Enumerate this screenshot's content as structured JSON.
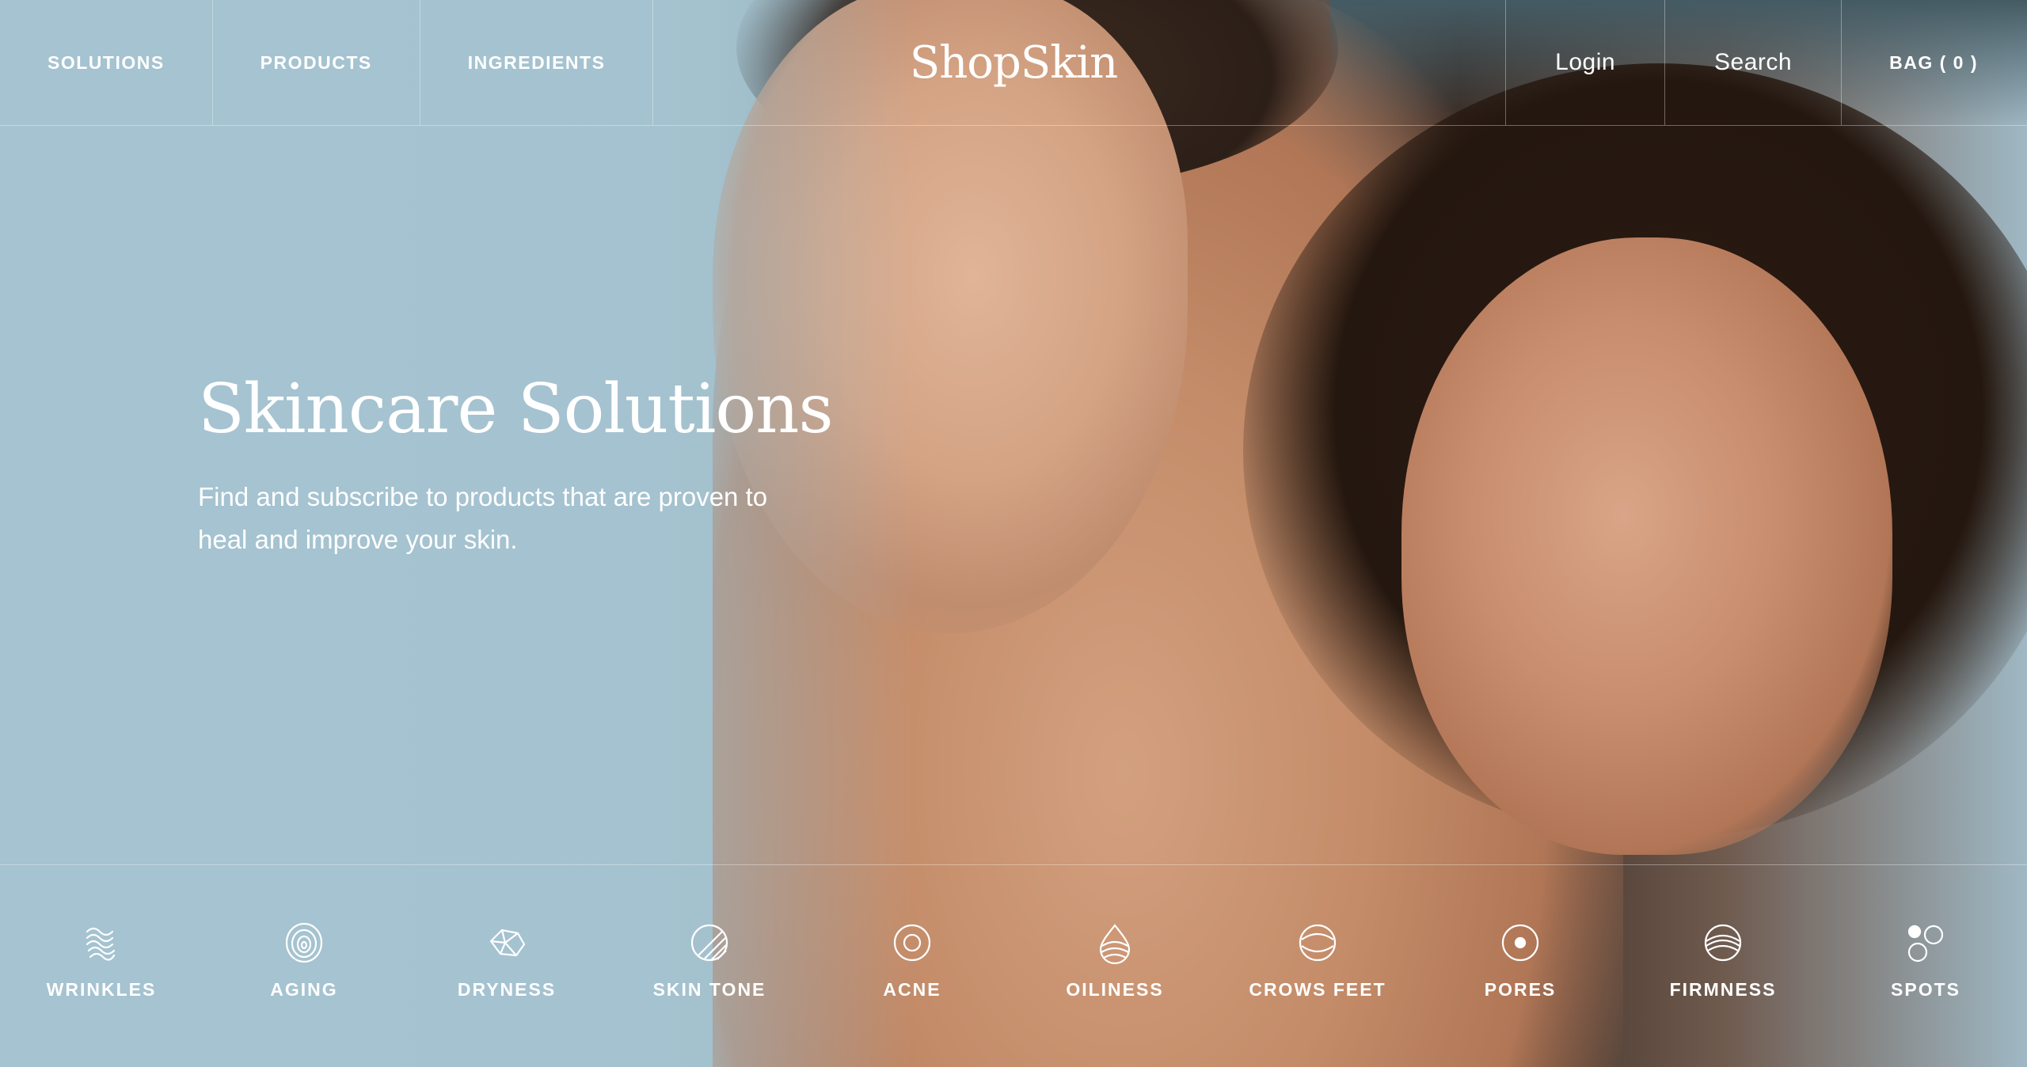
{
  "nav": {
    "left": [
      {
        "label": "SOLUTIONS"
      },
      {
        "label": "PRODUCTS"
      },
      {
        "label": "INGREDIENTS"
      }
    ],
    "brand": "ShopSkin",
    "right": [
      {
        "label": "Login"
      },
      {
        "label": "Search"
      },
      {
        "label": "BAG ( 0 )"
      }
    ]
  },
  "hero": {
    "title": "Skincare Solutions",
    "subtitle": "Find and subscribe to products that are proven to heal and improve your skin."
  },
  "categories": [
    {
      "label": "WRINKLES",
      "icon": "wrinkles-icon"
    },
    {
      "label": "AGING",
      "icon": "aging-icon"
    },
    {
      "label": "DRYNESS",
      "icon": "dryness-icon"
    },
    {
      "label": "SKIN TONE",
      "icon": "skin-tone-icon"
    },
    {
      "label": "ACNE",
      "icon": "acne-icon"
    },
    {
      "label": "OILINESS",
      "icon": "oiliness-icon"
    },
    {
      "label": "CROWS FEET",
      "icon": "crows-feet-icon"
    },
    {
      "label": "PORES",
      "icon": "pores-icon"
    },
    {
      "label": "FIRMNESS",
      "icon": "firmness-icon"
    },
    {
      "label": "SPOTS",
      "icon": "spots-icon"
    }
  ],
  "colors": {
    "background_blue": "#a7c3cf",
    "text": "#ffffff"
  }
}
